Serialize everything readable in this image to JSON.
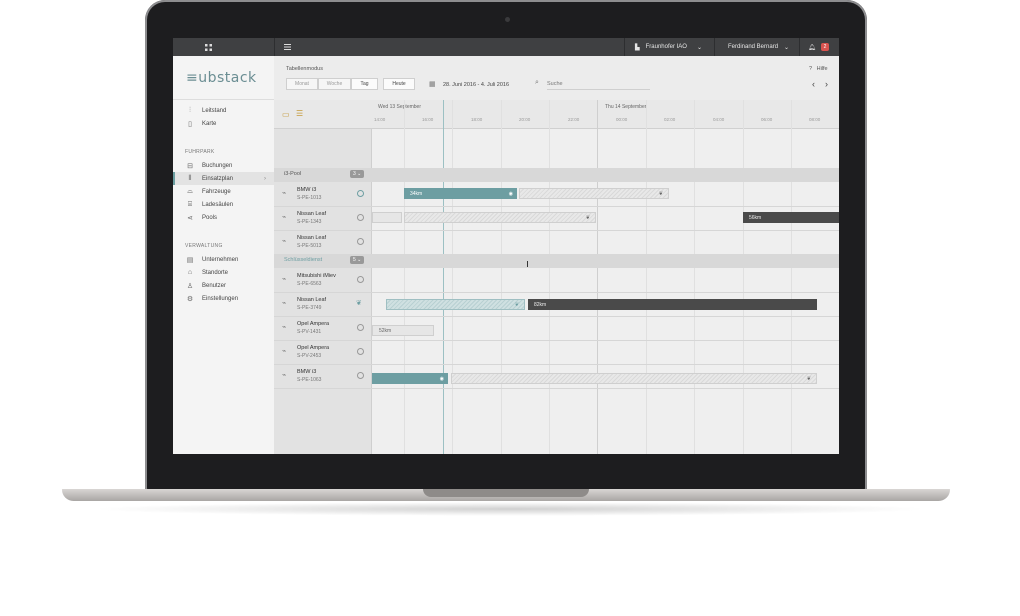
{
  "app": {
    "brand": "≡ubstack",
    "company": "Fraunhofer IAO",
    "user": "Ferdinand Bernard",
    "notification_count": "2"
  },
  "sidebar": {
    "items_top": [
      {
        "label": "Leitstand",
        "icon": "sliders-icon"
      },
      {
        "label": "Karte",
        "icon": "map-icon"
      }
    ],
    "section_fuhrpark": "FUHRPARK",
    "items_fuhrpark": [
      {
        "label": "Buchungen",
        "icon": "car-icon"
      },
      {
        "label": "Einsatzplan",
        "icon": "chart-icon",
        "active": true
      },
      {
        "label": "Fahrzeuge",
        "icon": "car-side-icon"
      },
      {
        "label": "Ladesäulen",
        "icon": "charger-icon"
      },
      {
        "label": "Pools",
        "icon": "share-icon"
      }
    ],
    "section_verwaltung": "VERWALTUNG",
    "items_verwaltung": [
      {
        "label": "Unternehmen",
        "icon": "building-icon"
      },
      {
        "label": "Standorte",
        "icon": "home-icon"
      },
      {
        "label": "Benutzer",
        "icon": "user-icon"
      },
      {
        "label": "Einstellungen",
        "icon": "gear-icon"
      }
    ]
  },
  "toolbar": {
    "mode": "Tabellenmodus",
    "views": [
      "Monat",
      "Woche",
      "Tag"
    ],
    "today": "Heute",
    "date_range": "28. Juni 2016 - 4. Juli 2016",
    "search_placeholder": "Suche",
    "help": "Hilfe"
  },
  "timeline": {
    "day1": "Wed 13 September",
    "day2": "Thu 14 September",
    "hours": [
      "14:00",
      "16:00",
      "18:00",
      "20:00",
      "22:00",
      "00:00",
      "02:00",
      "04:00",
      "06:00",
      "08:00"
    ]
  },
  "groups": [
    {
      "name": "i3-Pool",
      "count": "3"
    },
    {
      "name": "Schlüsseldienst",
      "count": "5"
    }
  ],
  "vehicles": [
    {
      "name": "BMW i3",
      "plate": "S-PE-1013"
    },
    {
      "name": "Nissan Leaf",
      "plate": "S-PE-1343"
    },
    {
      "name": "Nissan Leaf",
      "plate": "S-PE-5013"
    },
    {
      "name": "Mitsubishi iMiev",
      "plate": "S-PE-6563"
    },
    {
      "name": "Nissan Leaf",
      "plate": "S-PE-3749"
    },
    {
      "name": "Opel Ampera",
      "plate": "S-PV-1431"
    },
    {
      "name": "Opel Ampera",
      "plate": "S-PV-2453"
    },
    {
      "name": "BMW i3",
      "plate": "S-PE-1063"
    }
  ],
  "bookings": {
    "b1": "34km",
    "b2": "56km",
    "b3": "82km",
    "b4": "52km"
  }
}
